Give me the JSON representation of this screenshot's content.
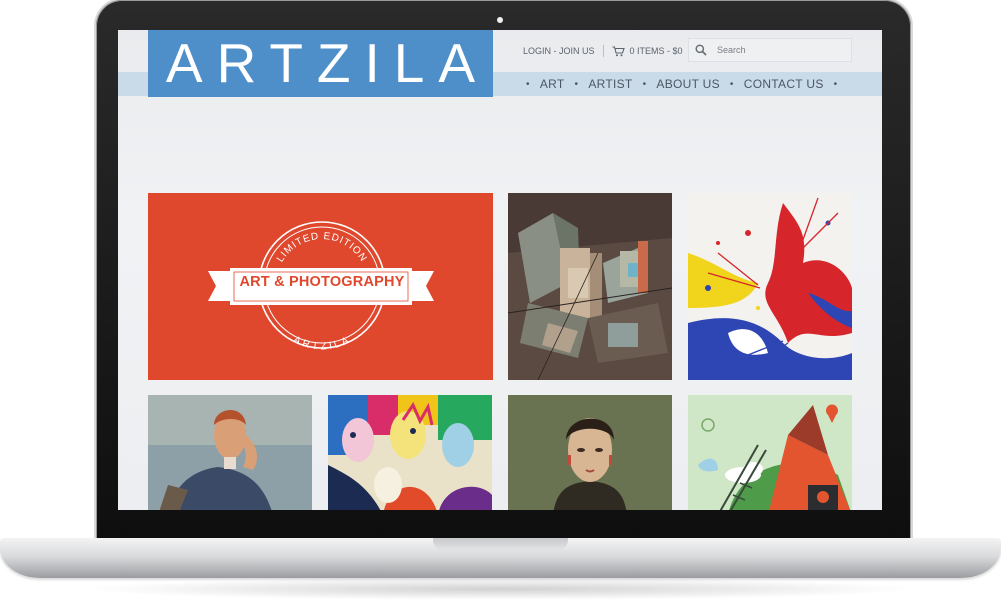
{
  "site": {
    "logo": "ARTZILA"
  },
  "header": {
    "login_join": "LOGIN - JOIN US",
    "cart": "0 ITEMS - $0",
    "search_placeholder": "Search"
  },
  "nav": {
    "items": [
      "ART",
      "ARTIST",
      "ABOUT US",
      "CONTACT US"
    ]
  },
  "promo": {
    "arc_top": "LIMITED EDITION",
    "banner": "ART & PHOTOGRAPHY",
    "arc_bottom": "ARTZILA"
  },
  "colors": {
    "logo_blue": "#4e8fc9",
    "nav_band": "#c9dbe9",
    "promo_red": "#e0482e"
  },
  "gallery": {
    "artworks": [
      "cubist-cityscape-painting",
      "paint-splatter-abstract",
      "seated-man-portrait",
      "colorful-crowd-painting",
      "woman-portrait-painting",
      "green-illustration"
    ]
  }
}
